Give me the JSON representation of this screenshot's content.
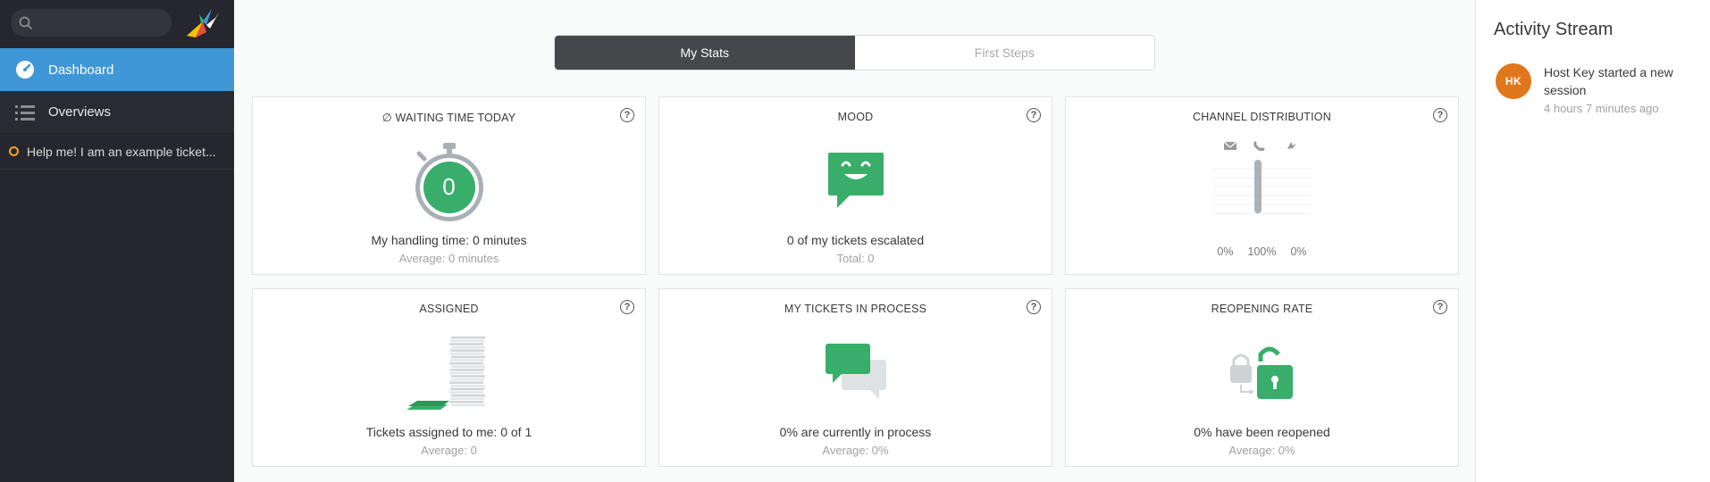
{
  "sidebar": {
    "search": {
      "placeholder": ""
    },
    "nav": [
      {
        "label": "Dashboard",
        "icon": "dashboard-icon"
      },
      {
        "label": "Overviews",
        "icon": "list-icon"
      }
    ],
    "ticket": {
      "label": "Help me! I am an example ticket..."
    }
  },
  "tabs": [
    {
      "label": "My Stats"
    },
    {
      "label": "First Steps"
    }
  ],
  "cards": {
    "waiting": {
      "title": "∅ WAITING TIME TODAY",
      "value": "0",
      "main": "My handling time: 0 minutes",
      "sub": "Average: 0 minutes"
    },
    "mood": {
      "title": "MOOD",
      "main": "0 of my tickets escalated",
      "sub": "Total: 0"
    },
    "channel": {
      "title": "CHANNEL DISTRIBUTION",
      "labels": [
        "0%",
        "100%",
        "0%"
      ],
      "shares": [
        0,
        1,
        0
      ]
    },
    "assigned": {
      "title": "ASSIGNED",
      "main": "Tickets assigned to me: 0 of 1",
      "sub": "Average: 0"
    },
    "in_process": {
      "title": "MY TICKETS IN PROCESS",
      "main": "0% are currently in process",
      "sub": "Average: 0%"
    },
    "reopening": {
      "title": "REOPENING RATE",
      "main": "0% have been reopened",
      "sub": "Average: 0%"
    }
  },
  "help_symbol": "?",
  "activity": {
    "title": "Activity Stream",
    "items": [
      {
        "initials": "HK",
        "text": "Host Key started a new session",
        "time": "4 hours 7 minutes ago"
      }
    ]
  },
  "colors": {
    "accent": "#3f97d7",
    "green": "#38ae6a",
    "avatar": "#e0771a",
    "sidebar": "#26272e"
  }
}
